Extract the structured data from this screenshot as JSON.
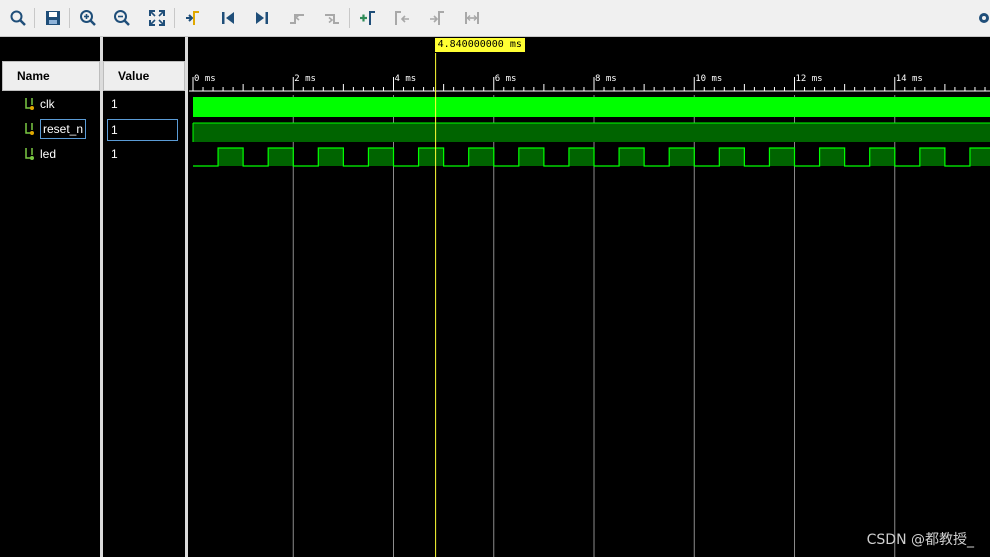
{
  "toolbar": {
    "buttons": [
      "zoom-search",
      "save",
      "zoom-in",
      "zoom-out",
      "zoom-fit",
      "go-to-cursor",
      "go-to-start",
      "go-to-end",
      "prev-transition",
      "next-transition",
      "add-marker",
      "prev-marker",
      "next-marker",
      "swap-cursors"
    ]
  },
  "columns": {
    "name": "Name",
    "value": "Value"
  },
  "signals": [
    {
      "name": "clk",
      "value": "1"
    },
    {
      "name": "reset_n",
      "value": "1"
    },
    {
      "name": "led",
      "value": "1"
    }
  ],
  "cursor": {
    "label": "4.840000000 ms",
    "time_ms": 4.84
  },
  "timeline": {
    "start_ms": 0,
    "end_ms": 15.9,
    "major_ticks_ms": [
      0,
      2,
      4,
      6,
      8,
      10,
      12,
      14
    ],
    "tick_labels": [
      "0 ms",
      "2 ms",
      "4 ms",
      "6 ms",
      "8 ms",
      "10 ms",
      "12 ms",
      "14 ms"
    ],
    "minor_per_major": 10
  },
  "led_wave": {
    "period_ms": 1.0,
    "first_rise_ms": 0.5
  },
  "colors": {
    "wave": "#00ff00",
    "bus_fill": "#006400",
    "grid": "#8c8c8c",
    "cursor": "#ffff33"
  },
  "watermark": "CSDN @都教授_"
}
